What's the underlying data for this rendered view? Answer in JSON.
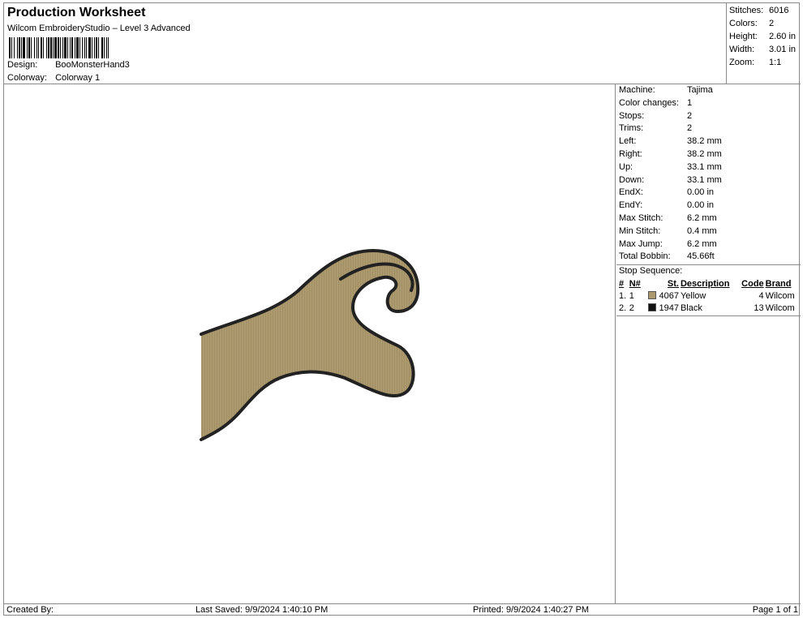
{
  "header": {
    "title": "Production Worksheet",
    "subtitle": "Wilcom EmbroideryStudio – Level 3 Advanced",
    "design_label": "Design:",
    "design_value": "BooMonsterHand3",
    "colorway_label": "Colorway:",
    "colorway_value": "Colorway 1"
  },
  "summary": [
    {
      "label": "Stitches:",
      "value": "6016"
    },
    {
      "label": "Colors:",
      "value": "2"
    },
    {
      "label": "Height:",
      "value": "2.60 in"
    },
    {
      "label": "Width:",
      "value": "3.01 in"
    },
    {
      "label": "Zoom:",
      "value": "1:1"
    }
  ],
  "machine_info": [
    {
      "label": "Machine:",
      "value": "Tajima"
    },
    {
      "label": "Color changes:",
      "value": "1"
    },
    {
      "label": "Stops:",
      "value": "2"
    },
    {
      "label": "Trims:",
      "value": "2"
    },
    {
      "label": "Left:",
      "value": "38.2 mm"
    },
    {
      "label": "Right:",
      "value": "38.2 mm"
    },
    {
      "label": "Up:",
      "value": "33.1 mm"
    },
    {
      "label": "Down:",
      "value": "33.1 mm"
    },
    {
      "label": "EndX:",
      "value": "0.00 in"
    },
    {
      "label": "EndY:",
      "value": "0.00 in"
    },
    {
      "label": "Max Stitch:",
      "value": "6.2 mm"
    },
    {
      "label": "Min Stitch:",
      "value": "0.4 mm"
    },
    {
      "label": "Max Jump:",
      "value": "6.2 mm"
    },
    {
      "label": "Total Bobbin:",
      "value": "45.66ft"
    }
  ],
  "stop_sequence": {
    "title": "Stop Sequence:",
    "headers": {
      "num": "#",
      "n": "N#",
      "st": "St.",
      "desc": "Description",
      "code": "Code",
      "brand": "Brand"
    },
    "rows": [
      {
        "num": "1.",
        "n": "1",
        "color": "#ac9a6e",
        "st": "4067",
        "desc": "Yellow",
        "code": "4",
        "brand": "Wilcom"
      },
      {
        "num": "2.",
        "n": "2",
        "color": "#111111",
        "st": "1947",
        "desc": "Black",
        "code": "13",
        "brand": "Wilcom"
      }
    ]
  },
  "footer": {
    "created_by": "Created By:",
    "last_saved": "Last Saved: 9/9/2024 1:40:10 PM",
    "printed": "Printed: 9/9/2024 1:40:27 PM",
    "page": "Page 1 of 1"
  },
  "colors": {
    "fill": "#ac9a6e",
    "outline": "#222222",
    "border": "#8a8a8a"
  }
}
